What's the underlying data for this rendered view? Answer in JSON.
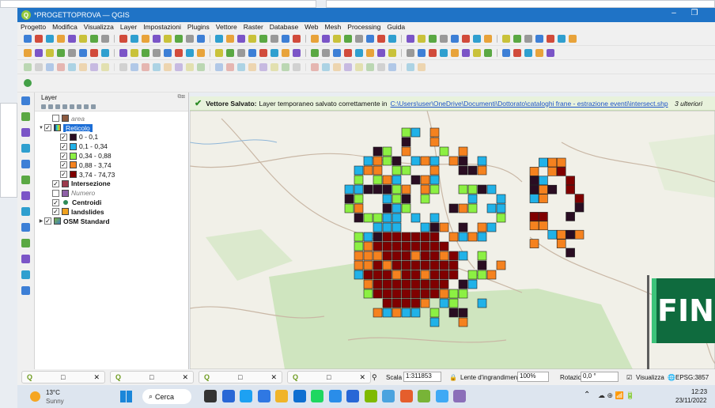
{
  "window": {
    "title": "*PROGETTOPROVA — QGIS",
    "logo_letter": "Q"
  },
  "menu": [
    "Progetto",
    "Modifica",
    "Visualizza",
    "Layer",
    "Impostazioni",
    "Plugins",
    "Vettore",
    "Raster",
    "Database",
    "Web",
    "Mesh",
    "Processing",
    "Guida"
  ],
  "layers_panel": {
    "title": "Layer",
    "items": [
      {
        "label": "area",
        "checked": false,
        "style": "ital",
        "swatch": "#8d5a3f",
        "indent": 1
      },
      {
        "label": "Reticolo",
        "checked": true,
        "style": "sel",
        "swatch": "grid",
        "indent": 0,
        "expand": "▼"
      },
      {
        "label": "0 - 0,1",
        "checked": true,
        "swatch": "#2a0d22",
        "indent": 2
      },
      {
        "label": "0,1 - 0,34",
        "checked": true,
        "swatch": "#21b2e8",
        "indent": 2
      },
      {
        "label": "0,34 - 0,88",
        "checked": true,
        "swatch": "#8cf043",
        "indent": 2
      },
      {
        "label": "0,88 - 3,74",
        "checked": true,
        "swatch": "#f5821f",
        "indent": 2
      },
      {
        "label": "3,74 - 74,73",
        "checked": true,
        "swatch": "#800000",
        "indent": 2
      },
      {
        "label": "Intersezione",
        "checked": true,
        "style": "bold",
        "swatch": "#9b3a4c",
        "indent": 1
      },
      {
        "label": "Numero",
        "checked": false,
        "style": "ital",
        "swatch": "#8e5fa6",
        "indent": 1
      },
      {
        "label": "Centroidi",
        "checked": true,
        "style": "bold",
        "swatch": "dot",
        "indent": 1
      },
      {
        "label": "landslides",
        "checked": true,
        "style": "bold",
        "swatch": "#f0a21f",
        "indent": 1
      },
      {
        "label": "OSM Standard",
        "checked": true,
        "style": "bold",
        "swatch": "osm",
        "indent": 0,
        "expand": "▶"
      }
    ]
  },
  "message": {
    "title": "Vettore Salvato:",
    "text": "Layer temporaneo salvato correttamente in",
    "link": "C:\\Users\\user\\OneDrive\\Documenti\\Dottorato\\cataloghi frane - estrazione eventi\\intersect.shp",
    "more": "3 ulteriori"
  },
  "status": {
    "scale_label": "Scala",
    "scale_value": "1:311853",
    "magnifier_label": "Lente d'ingrandimento",
    "magnifier_value": "100%",
    "rotation_label": "Rotazione",
    "rotation_value": "0,0 °",
    "render_label": "Visualizza",
    "crs": "EPSG:3857"
  },
  "taskbar": {
    "temp": "13°C",
    "weather": "Sunny",
    "search": "Cerca",
    "time": "12:23",
    "date": "23/11/2022"
  },
  "overlay": {
    "sign_text": "FIN"
  },
  "colors": {
    "class1": "#2a0d22",
    "class2": "#21b2e8",
    "class3": "#8cf043",
    "class4": "#f5821f",
    "class5": "#800000",
    "accent": "#1c6ed6"
  }
}
